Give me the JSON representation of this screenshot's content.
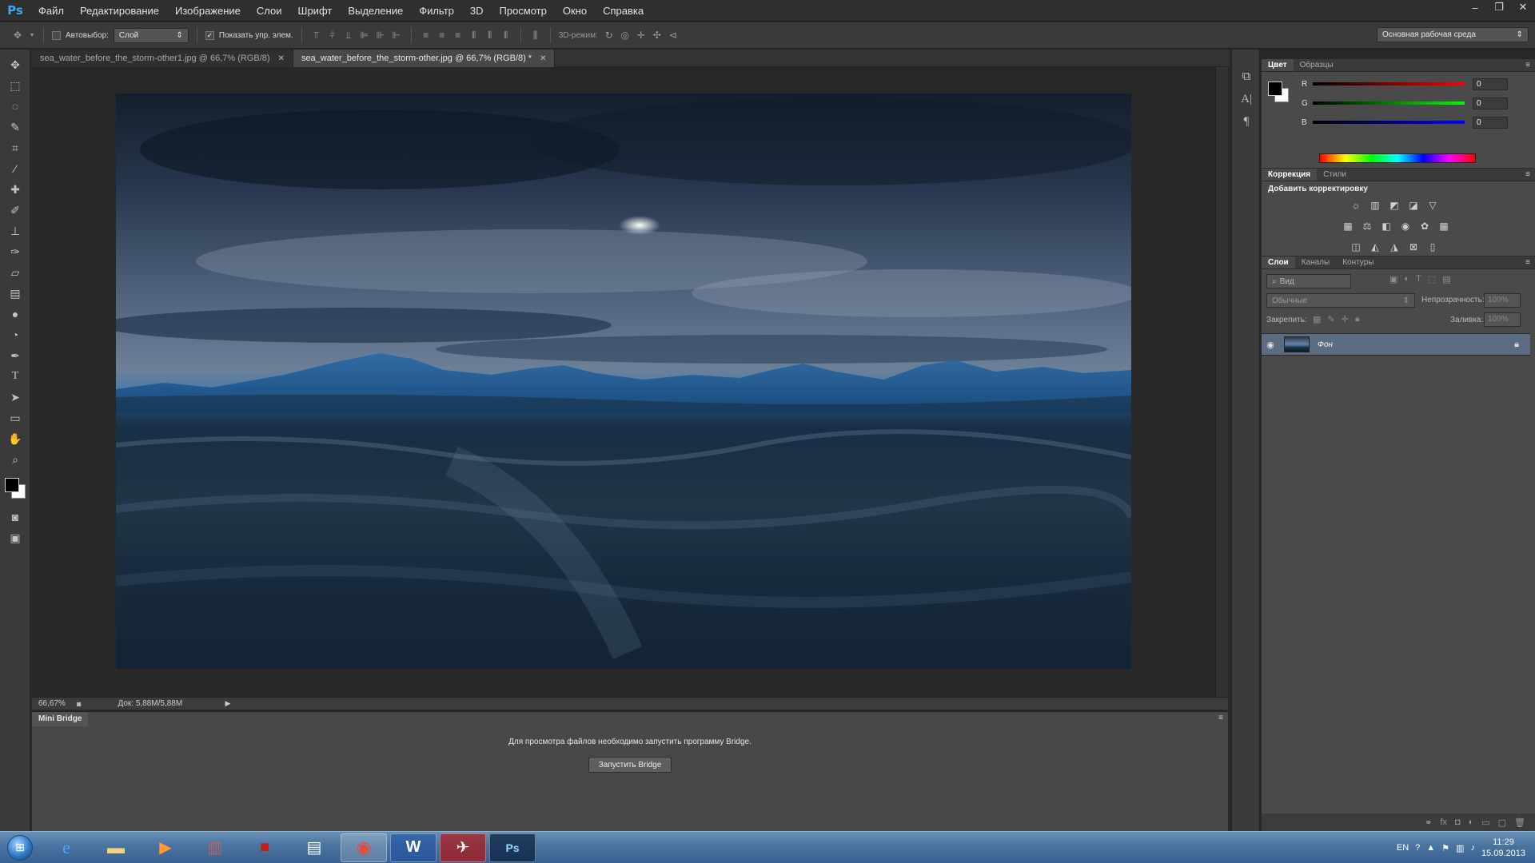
{
  "menu": {
    "logo": "Ps",
    "items": [
      "Файл",
      "Редактирование",
      "Изображение",
      "Слои",
      "Шрифт",
      "Выделение",
      "Фильтр",
      "3D",
      "Просмотр",
      "Окно",
      "Справка"
    ]
  },
  "options": {
    "autoselect_label": "Автовыбор:",
    "autoselect_value": "Слой",
    "show_transform_label": "Показать упр. элем.",
    "mode3d_label": "3D-режим:",
    "workspace": "Основная рабочая среда"
  },
  "tabs": [
    {
      "label": "sea_water_before_the_storm-other1.jpg @ 66,7% (RGB/8)"
    },
    {
      "label": "sea_water_before_the_storm-other.jpg @ 66,7% (RGB/8) *"
    }
  ],
  "status": {
    "zoom": "66,67%",
    "doc": "Док: 5,88M/5,88M"
  },
  "minibridge": {
    "tab": "Mini Bridge",
    "message": "Для просмотра файлов необходимо запустить программу Bridge.",
    "button": "Запустить Bridge"
  },
  "color_panel": {
    "tabs": [
      "Цвет",
      "Образцы"
    ],
    "r_label": "R",
    "g_label": "G",
    "b_label": "B",
    "r": "0",
    "g": "0",
    "b": "0",
    "fg_color": "#000000",
    "bg_color": "#ffffff"
  },
  "adjust_panel": {
    "tabs": [
      "Коррекция",
      "Стили"
    ],
    "title": "Добавить корректировку"
  },
  "layers_panel": {
    "tabs": [
      "Слои",
      "Каналы",
      "Контуры"
    ],
    "filter": "Вид",
    "blend": "Обычные",
    "opacity_label": "Непрозрачность:",
    "opacity": "100%",
    "lock_label": "Закрепить:",
    "fill_label": "Заливка:",
    "fill": "100%",
    "layer_name": "Фон"
  },
  "tray": {
    "lang": "EN",
    "time": "11:29",
    "date": "15.09.2013"
  }
}
